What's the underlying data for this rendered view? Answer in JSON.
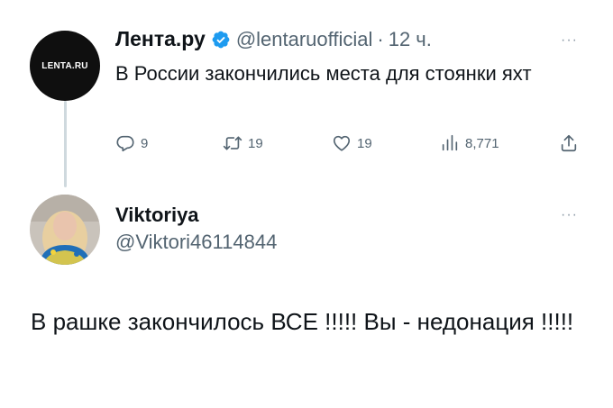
{
  "tweet1": {
    "avatar_text": "LENTA.RU",
    "name": "Лента.ру",
    "handle": "@lentaruofficial",
    "separator": "·",
    "time": "12 ч.",
    "more": "···",
    "text": "В России закончились места для стоянки яхт",
    "actions": {
      "replies": "9",
      "retweets": "19",
      "likes": "19",
      "views": "8,771"
    }
  },
  "tweet2": {
    "name": "Viktoriya",
    "handle": "@Viktori46114844",
    "more": "···",
    "text": "В рашке закончилось ВСЕ !!!!! Вы - недонация !!!!!"
  },
  "colors": {
    "verified_blue": "#1d9bf0",
    "muted_gray": "#536471",
    "thread_line": "#cfd9de"
  },
  "icons": [
    "verified-badge-icon",
    "reply-icon",
    "retweet-icon",
    "like-icon",
    "views-icon",
    "share-icon",
    "more-icon"
  ]
}
